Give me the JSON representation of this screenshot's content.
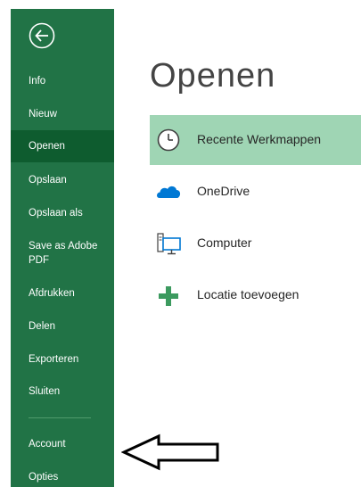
{
  "sidebar": {
    "items": [
      {
        "label": "Info"
      },
      {
        "label": "Nieuw"
      },
      {
        "label": "Openen"
      },
      {
        "label": "Opslaan"
      },
      {
        "label": "Opslaan als"
      },
      {
        "label": "Save as Adobe PDF"
      },
      {
        "label": "Afdrukken"
      },
      {
        "label": "Delen"
      },
      {
        "label": "Exporteren"
      },
      {
        "label": "Sluiten"
      },
      {
        "label": "Account"
      },
      {
        "label": "Opties"
      }
    ],
    "active_item": "Openen"
  },
  "main": {
    "title": "Openen",
    "locations": [
      {
        "label": "Recente Werkmappen",
        "icon": "clock-icon",
        "selected": true
      },
      {
        "label": "OneDrive",
        "icon": "cloud-icon",
        "selected": false
      },
      {
        "label": "Computer",
        "icon": "computer-icon",
        "selected": false
      },
      {
        "label": "Locatie toevoegen",
        "icon": "plus-icon",
        "selected": false
      }
    ]
  },
  "colors": {
    "sidebar": "#217346",
    "sidebar_active": "#0e5c2f",
    "selected_location": "#9fd5b4",
    "onedrive_blue": "#0078d4",
    "plus_green": "#3c9a5f"
  }
}
